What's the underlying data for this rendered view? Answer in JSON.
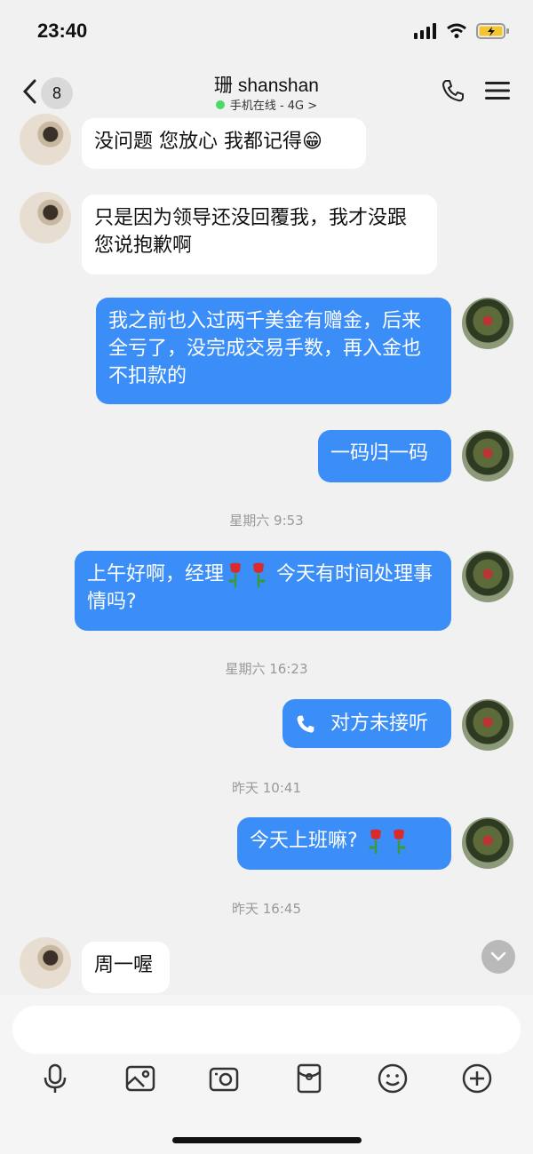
{
  "status": {
    "time": "23:40"
  },
  "header": {
    "back_badge": "8",
    "title": "珊 shanshan",
    "subtitle": "手机在线 - 4G >"
  },
  "messages": [
    {
      "side": "in",
      "text": "没问题 您放心 我都记得😁"
    },
    {
      "side": "in",
      "text": "只是因为领导还没回覆我，我才没跟您说抱歉啊"
    },
    {
      "side": "out",
      "text": "我之前也入过两千美金有赠金，后来全亏了，没完成交易手数，再入金也不扣款的"
    },
    {
      "side": "out",
      "text": "一码归一码"
    },
    {
      "type": "time",
      "text": "星期六 9:53"
    },
    {
      "side": "out",
      "text_before": "上午好啊，经理",
      "text_after": " 今天有时间处理事情吗?"
    },
    {
      "type": "time",
      "text": "星期六 16:23"
    },
    {
      "side": "out",
      "text": "对方未接听",
      "call": true
    },
    {
      "type": "time",
      "text": "昨天 10:41"
    },
    {
      "side": "out",
      "text": "今天上班嘛? "
    },
    {
      "type": "time",
      "text": "昨天 16:45"
    },
    {
      "side": "in",
      "text": "周一喔"
    }
  ],
  "toolbar": [
    "mic-icon",
    "image-icon",
    "camera-icon",
    "red-packet-icon",
    "emoji-icon",
    "plus-icon"
  ],
  "colors": {
    "outgoing_bubble": "#3b8ef7",
    "incoming_bubble": "#ffffff",
    "background": "#f1f1f1"
  }
}
